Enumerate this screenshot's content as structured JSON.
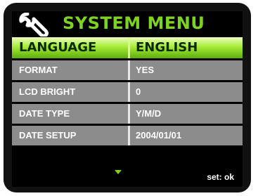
{
  "header": {
    "title": "SYSTEM MENU",
    "icon": "wrench-icon"
  },
  "menu": {
    "items": [
      {
        "label": "LANGUAGE",
        "value": "ENGLISH",
        "selected": true
      },
      {
        "label": "FORMAT",
        "value": "YES"
      },
      {
        "label": "LCD BRIGHT",
        "value": "0"
      },
      {
        "label": "DATE TYPE",
        "value": "Y/M/D"
      },
      {
        "label": "DATE SETUP",
        "value": "2004/01/01"
      }
    ]
  },
  "footer": {
    "scroll_icon": "scroll-down-arrow-icon",
    "hint": "set: ok"
  },
  "colors": {
    "accent_green": "#7ed321",
    "row_gray": "#8c8c8c",
    "background": "#000000"
  }
}
